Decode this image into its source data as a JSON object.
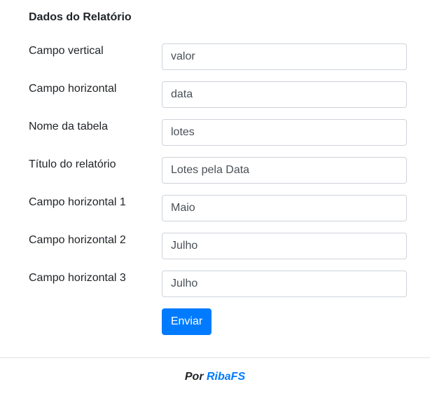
{
  "form": {
    "title": "Dados do Relatório",
    "fields": [
      {
        "label": "Campo vertical",
        "value": "valor"
      },
      {
        "label": "Campo horizontal",
        "value": "data"
      },
      {
        "label": "Nome da tabela",
        "value": "lotes"
      },
      {
        "label": "Título do relatório",
        "value": "Lotes pela Data"
      },
      {
        "label": "Campo horizontal 1",
        "value": "Maio"
      },
      {
        "label": "Campo horizontal 2",
        "value": "Julho"
      },
      {
        "label": "Campo horizontal 3",
        "value": "Julho"
      }
    ],
    "submit_label": "Enviar"
  },
  "footer": {
    "prefix": "Por",
    "author_link": "RibaFS"
  },
  "colors": {
    "primary": "#007bff",
    "text": "#212529",
    "input_text": "#495057",
    "border": "#ced4da"
  }
}
